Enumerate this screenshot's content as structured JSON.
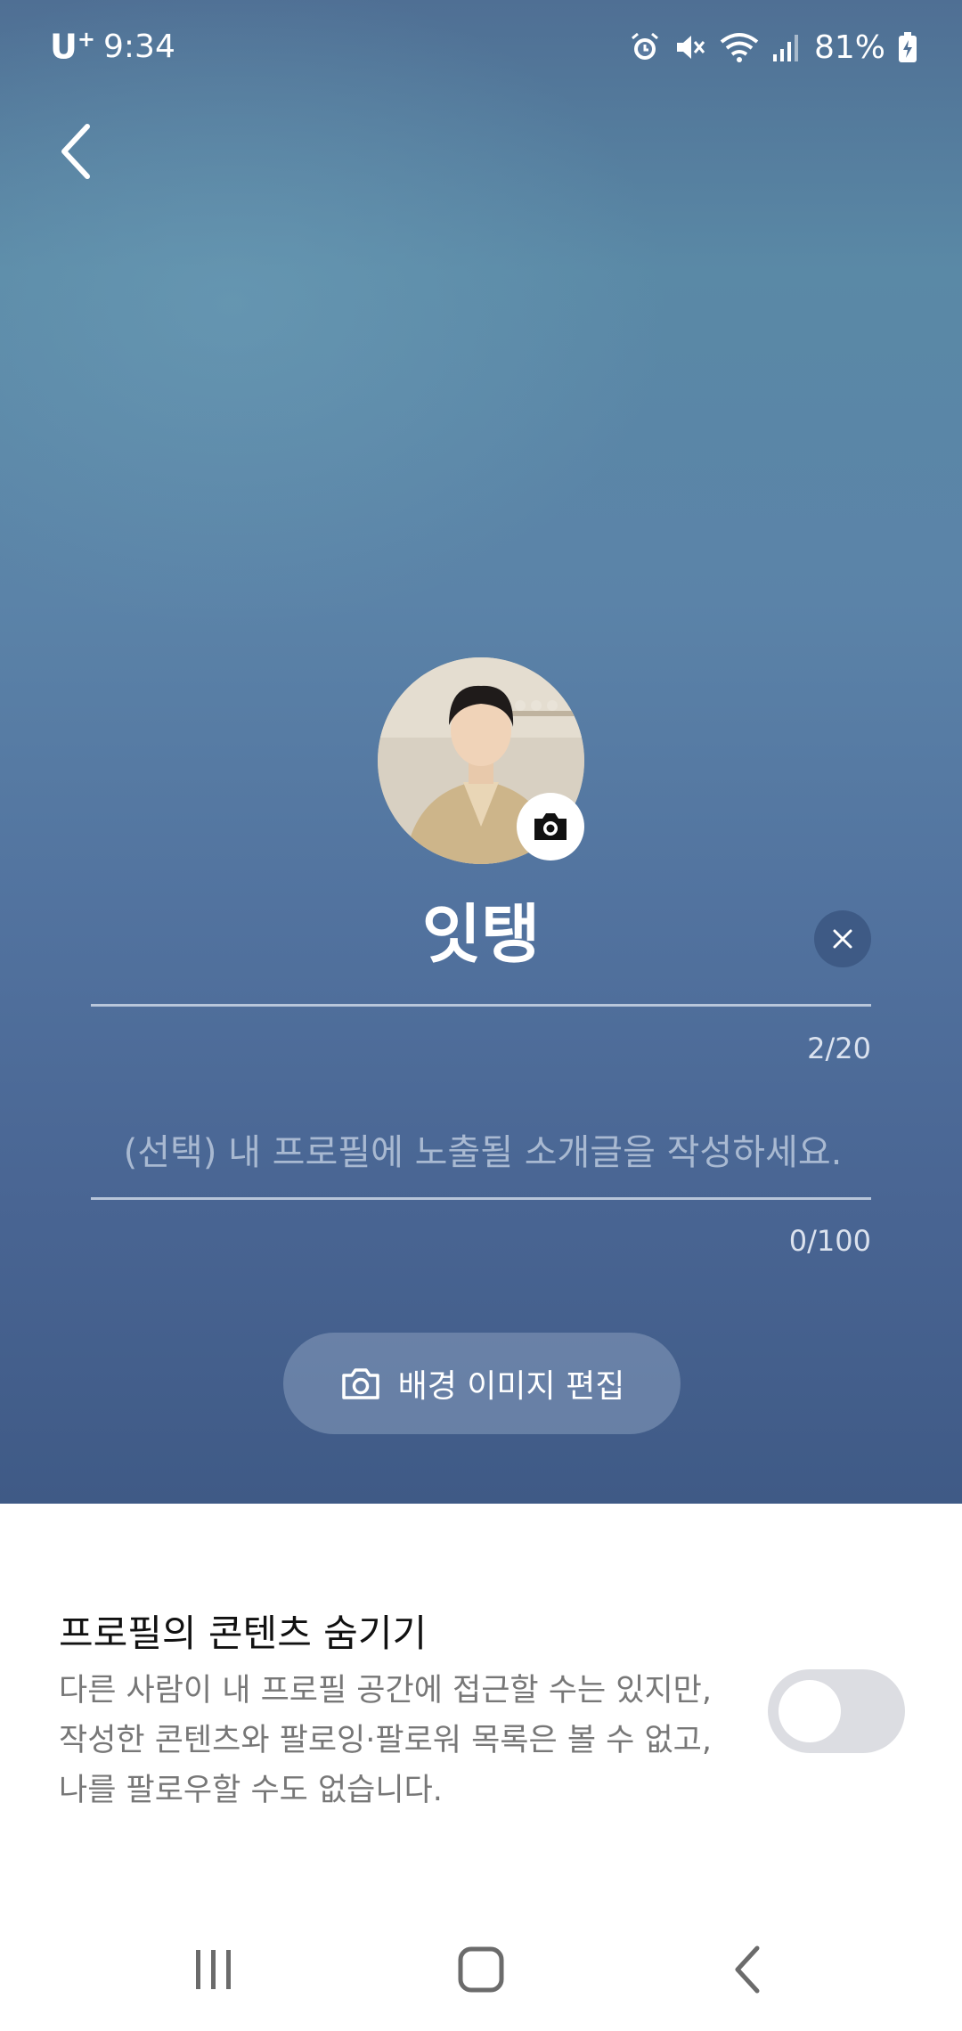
{
  "status_bar": {
    "carrier": "U",
    "carrier_sup": "+",
    "time": "9:34",
    "battery": "81%"
  },
  "profile": {
    "name": "잇탱",
    "name_counter": "2/20",
    "bio_placeholder": "(선택) 내 프로필에 노출될 소개글을 작성하세요.",
    "bio_value": "",
    "bio_counter": "0/100",
    "bg_edit_label": "배경 이미지 편집"
  },
  "settings": {
    "hide_content_title": "프로필의 콘텐츠 숨기기",
    "hide_content_desc": "다른 사람이 내 프로필 공간에 접근할 수는 있지만, 작성한 콘텐츠와 팔로잉·팔로워 목록은 볼 수 없고, 나를 팔로우할 수도 없습니다.",
    "hide_content_enabled": false
  },
  "colors": {
    "hero_top": "#4f6f94",
    "hero_bottom": "#3f5a86",
    "toggle_off": "#dcdde2"
  },
  "icons": [
    "back-icon",
    "camera-icon",
    "clear-icon",
    "alarm-icon",
    "mute-icon",
    "wifi-icon",
    "signal-icon",
    "battery-icon",
    "recents-icon",
    "home-icon",
    "nav-back-icon"
  ]
}
